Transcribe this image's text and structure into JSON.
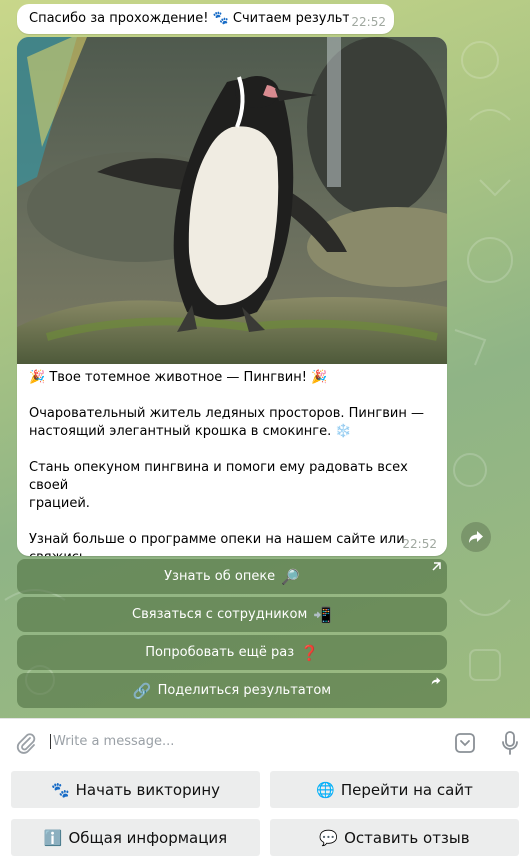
{
  "messages": {
    "first": {
      "text": "Спасибо за прохождение! 🐾 Считаем результат...",
      "time": "22:52"
    },
    "result": {
      "line1": "🎉 Твое тотемное животное — Пингвин! 🎉",
      "line2": "Очаровательный житель ледяных просторов. Пингвин —\nнастоящий элегантный крошка в смокинге. ❄️",
      "line3": "Стань опекуном пингвина и помоги ему радовать всех своей\nграцией.",
      "line4": "Узнай больше о программе опеки на нашем сайте или свяжись\nс нами — мы всегда рады помочь!",
      "time": "22:52"
    }
  },
  "inline_buttons": [
    {
      "label": "Узнать об опеке",
      "emoji": "🔎"
    },
    {
      "label": "Связаться с сотрудником",
      "emoji": "📲"
    },
    {
      "label": "Попробовать ещё раз",
      "emoji": "❓"
    },
    {
      "label": "Поделиться результатом",
      "emoji": "🔗"
    }
  ],
  "composer": {
    "placeholder": "Write a message..."
  },
  "reply_keyboard": [
    {
      "label": "Начать викторину",
      "emoji": "🐾"
    },
    {
      "label": "Перейти на сайт",
      "emoji": "🌐"
    },
    {
      "label": "Общая информация",
      "emoji": "ℹ️"
    },
    {
      "label": "Оставить отзыв",
      "emoji": "💬"
    }
  ],
  "colors": {
    "inline_button_bg": "#48693c",
    "chat_bg": "#a9c483",
    "bubble_bg": "#ffffff"
  },
  "icons": [
    "paperclip-icon",
    "sticker-icon",
    "microphone-icon",
    "share-arrow-icon",
    "external-link-icon"
  ]
}
